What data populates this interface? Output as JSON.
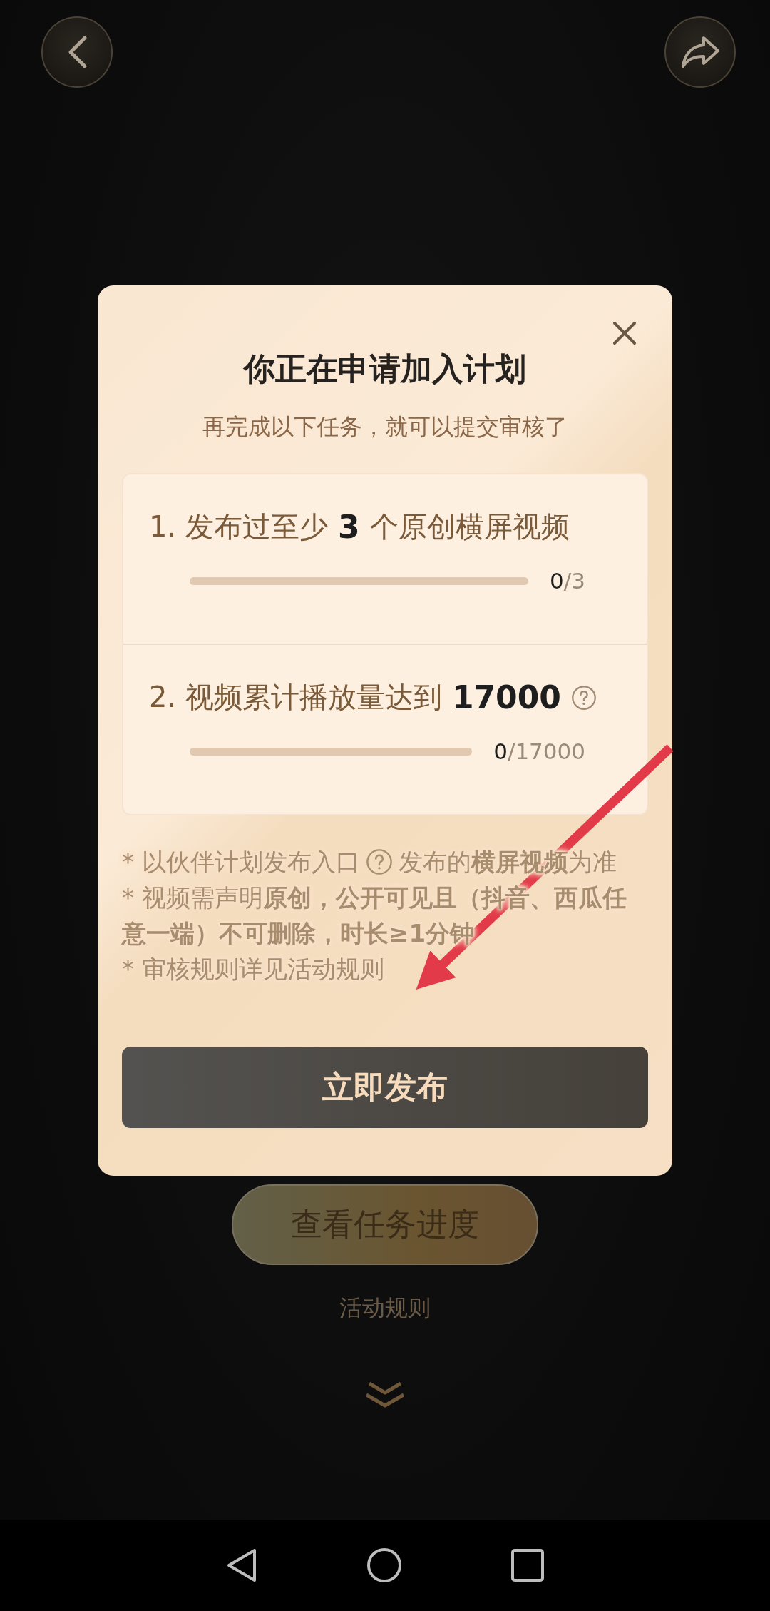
{
  "dialog": {
    "title": "你正在申请加入计划",
    "subtitle": "再完成以下任务，就可以提交审核了",
    "tasks": [
      {
        "prefix": "1. 发布过至少",
        "amount": "3",
        "suffix": "个原创横屏视频",
        "help": false,
        "done": "0",
        "total": "/3",
        "level": 0
      },
      {
        "prefix": "2. 视频累计播放量达到",
        "amount": "17000",
        "help": true,
        "done": "0",
        "total": "/17000",
        "level": 0
      }
    ],
    "notes": [
      {
        "before": "* 以伙伴计划发布入口",
        "help": true,
        "after": "发布的**横屏视频**为准"
      },
      {
        "before": "* 视频需声明**原创，公开可见且（抖音、西瓜任意一端）不可删除，时长≥1分钟**",
        "help": false
      },
      {
        "before": "* 审核规则详见活动规则",
        "help": false
      }
    ],
    "button": "立即发布"
  },
  "progress_button": "查看任务进度",
  "rules_link": "活动规则"
}
